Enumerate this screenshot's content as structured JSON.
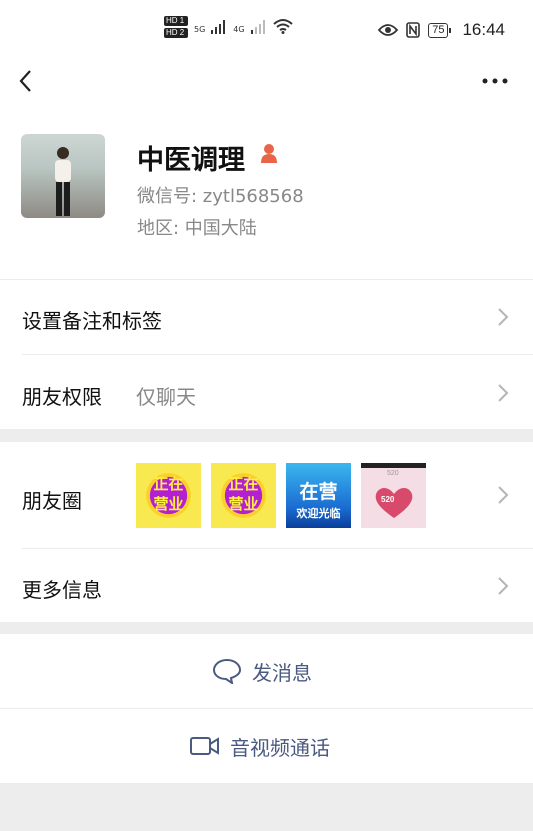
{
  "status_bar": {
    "sig_5g": "5G",
    "sig_4g": "4G",
    "hd1": "HD 1",
    "hd2": "HD 2",
    "battery": "75",
    "time": "16:44"
  },
  "nav": {
    "back_icon": "chevron-left-icon",
    "more_icon": "more-dots-icon"
  },
  "profile": {
    "name": "中医调理",
    "wechat_id": "微信号: zytl568568",
    "region": "地区: 中国大陆",
    "gender_icon": "female-icon"
  },
  "rows": {
    "remark": {
      "label": "设置备注和标签"
    },
    "permission": {
      "label": "朋友权限",
      "value": "仅聊天"
    },
    "moments": {
      "label": "朋友圈",
      "thumbs": [
        {
          "line1": "正在",
          "line2": "营业"
        },
        {
          "line1": "正在",
          "line2": "营业"
        },
        {
          "line1": "在营",
          "line2": "欢迎光临"
        },
        {
          "top": "520",
          "mid": "520"
        }
      ]
    },
    "more_info": {
      "label": "更多信息"
    }
  },
  "actions": {
    "message": {
      "label": "发消息",
      "icon": "chat-bubble-icon"
    },
    "video_call": {
      "label": "音视频通话",
      "icon": "video-camera-icon"
    }
  },
  "colors": {
    "link": "#4b5a80",
    "gap": "#ededed",
    "gender": "#e8654a"
  }
}
